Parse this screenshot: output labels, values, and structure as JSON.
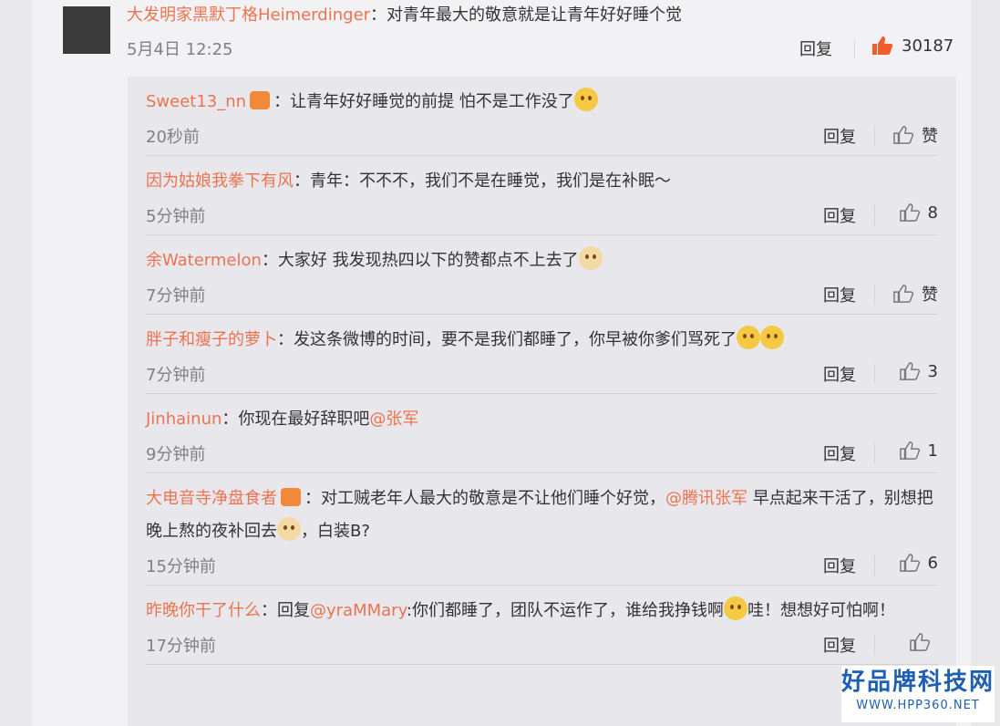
{
  "top": {
    "user": "大发明家黑默丁格Heimerdinger",
    "colon": "：",
    "text": "对青年最大的敬意就是让青年好好睡个觉",
    "time": "5月4日 12:25",
    "reply": "回复",
    "likes": "30187"
  },
  "replies": [
    {
      "user": "Sweet13_nn",
      "badge": true,
      "text": "：让青年好好睡觉的前提 怕不是工作没了",
      "emoji": "emoji",
      "time": "20秒前",
      "reply": "回复",
      "like": "赞"
    },
    {
      "user": "因为姑娘我拳下有风",
      "text": "：青年：不不不，我们不是在睡觉，我们是在补眠～",
      "time": "5分钟前",
      "reply": "回复",
      "like": "8"
    },
    {
      "user": "余Watermelon",
      "text": "：大家好 我发现热四以下的赞都点不上去了",
      "emoji": "dog",
      "time": "7分钟前",
      "reply": "回复",
      "like": "赞"
    },
    {
      "user": "胖子和瘦子的萝卜",
      "text": "：发这条微博的时间，要不是我们都睡了，你早被你爹们骂死了",
      "emoji": "emoji2",
      "time": "7分钟前",
      "reply": "回复",
      "like": "3"
    },
    {
      "user": "Jinhainun",
      "text": "：你现在最好辞职吧",
      "at": "@张军",
      "time": "9分钟前",
      "reply": "回复",
      "like": "1"
    },
    {
      "user": "大电音寺净盘食者",
      "badge": true,
      "text": "：对工贼老年人最大的敬意是不让他们睡个好觉，",
      "at": "@腾讯张军",
      "text2": " 早点起来干活了，别想把晚上熬的夜补回去",
      "text3": "，白装B?",
      "time": "15分钟前",
      "reply": "回复",
      "like": "6"
    },
    {
      "user": "昨晚你干了什么",
      "text": "：回复",
      "at": "@yraMMary",
      "text2": ":你们都睡了，团队不运作了，谁给我挣钱啊",
      "text3": "哇！想想好可怕啊！",
      "time": "17分钟前",
      "reply": "回复",
      "like": ""
    }
  ],
  "watermark": {
    "top": "好品牌科技网",
    "bottom": "WWW.HPP360.NET"
  }
}
